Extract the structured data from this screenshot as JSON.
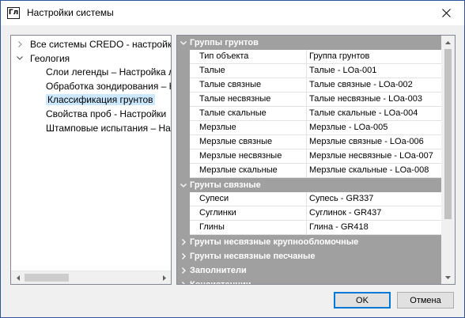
{
  "window": {
    "title": "Настройки системы",
    "icon_text": "Гл"
  },
  "tree": {
    "items": [
      {
        "label": "Все системы CREDO - настройки",
        "arrow": "right",
        "level": 0
      },
      {
        "label": "Геология",
        "arrow": "down",
        "level": 0
      },
      {
        "label": "Слои легенды – Настройка легенды",
        "arrow": "",
        "level": 1
      },
      {
        "label": "Обработка зондирования – Настройки",
        "arrow": "",
        "level": 1
      },
      {
        "label": "Классификация грунтов",
        "arrow": "",
        "level": 1,
        "selected": true
      },
      {
        "label": "Свойства проб - Настройки",
        "arrow": "",
        "level": 1
      },
      {
        "label": "Штамповые испытания – Настройки",
        "arrow": "",
        "level": 1
      }
    ]
  },
  "grid": {
    "categories": [
      {
        "label": "Группы грунтов",
        "expanded": true,
        "rows": [
          {
            "name": "Тип объекта",
            "value": "Группа грунтов"
          },
          {
            "name": "Талые",
            "value": "Талые - LOa-001"
          },
          {
            "name": "Талые связные",
            "value": "Талые связные - LOa-002"
          },
          {
            "name": "Талые несвязные",
            "value": "Талые несвязные - LOa-003"
          },
          {
            "name": "Талые скальные",
            "value": "Талые скальные - LOa-004"
          },
          {
            "name": "Мерзлые",
            "value": "Мерзлые - LOa-005"
          },
          {
            "name": "Мерзлые связные",
            "value": "Мерзлые связные - LOa-006"
          },
          {
            "name": "Мерзлые несвязные",
            "value": "Мерзлые несвязные - LOa-007"
          },
          {
            "name": "Мерзлые скальные",
            "value": "Мерзлые скальные - LOa-008"
          }
        ]
      },
      {
        "label": "Грунты связные",
        "expanded": true,
        "rows": [
          {
            "name": "Супеси",
            "value": "Супесь - GR337"
          },
          {
            "name": "Суглинки",
            "value": "Суглинок - GR437"
          },
          {
            "name": "Глины",
            "value": "Глина - GR418"
          }
        ]
      },
      {
        "label": "Грунты несвязные крупнообломочные",
        "expanded": false,
        "rows": []
      },
      {
        "label": "Грунты несвязные песчаные",
        "expanded": false,
        "rows": []
      },
      {
        "label": "Заполнители",
        "expanded": false,
        "rows": []
      },
      {
        "label": "Консистенции",
        "expanded": false,
        "rows": []
      }
    ]
  },
  "buttons": {
    "ok": "OK",
    "cancel": "Отмена"
  },
  "icons": {
    "close": "close-icon",
    "expand": "chevron-right-icon",
    "collapse": "chevron-down-icon"
  },
  "colors": {
    "category_bg": "#a0a0a0",
    "selected_bg": "#cce8ff",
    "default_button_border": "#0078d7"
  }
}
